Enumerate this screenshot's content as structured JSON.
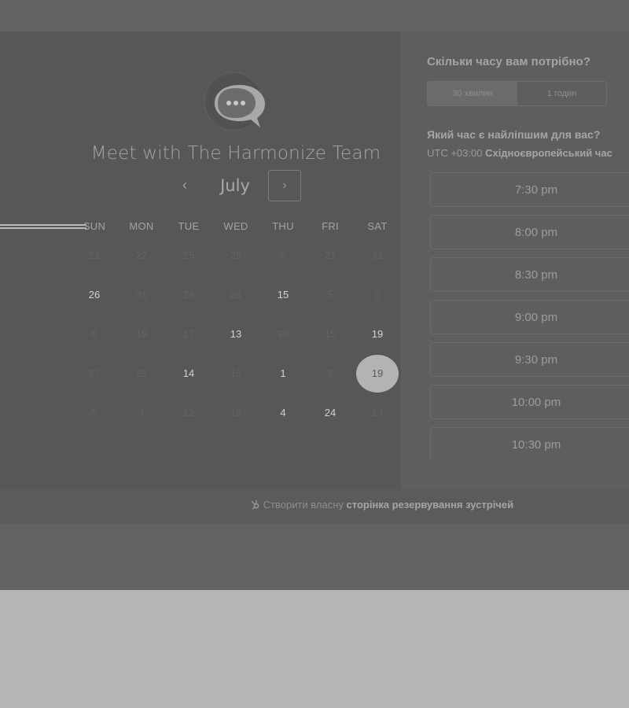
{
  "page": {
    "backdrop_color": "#b5b5b5",
    "overlay_color": "#636363"
  },
  "calendar": {
    "title": "Meet with The Harmonize Team",
    "month": "July",
    "prev_icon": "‹",
    "next_icon": "›",
    "weekdays": [
      "SUN",
      "MON",
      "TUE",
      "WED",
      "THU",
      "FRI",
      "SAT"
    ],
    "weeks": [
      [
        "21",
        "22",
        "25",
        "28",
        "6",
        "21",
        "31"
      ],
      [
        "26",
        "31",
        "29",
        "26",
        "15",
        "5",
        "8"
      ],
      [
        "6",
        "19",
        "17",
        "13",
        "30",
        "15",
        "19"
      ],
      [
        "27",
        "29",
        "14",
        "13",
        "1",
        "2",
        "19"
      ],
      [
        "5",
        "4",
        "12",
        "18",
        "4",
        "24",
        "14"
      ]
    ],
    "enabled": [
      [],
      [
        0,
        4
      ],
      [
        3,
        6
      ],
      [
        2,
        4
      ],
      [
        4,
        5
      ]
    ],
    "selected": {
      "week": 3,
      "day": 6
    }
  },
  "booking": {
    "duration_question": "Скільки часу вам потрібно?",
    "durations": [
      "30 хвилин",
      "1 годин"
    ],
    "active_duration": 0,
    "time_question": "Який час є найліпшим для вас?",
    "timezone_offset": "UTC +03:00",
    "timezone_name": "Східноєвропейський час",
    "slots": [
      "7:30 pm",
      "8:00 pm",
      "8:30 pm",
      "9:00 pm",
      "9:30 pm",
      "10:00 pm",
      "10:30 pm"
    ]
  },
  "footer": {
    "icon": "hubspot-sprocket-icon",
    "link_prefix": "Створити власну",
    "link_bold": "сторінка резервування зустрічей"
  }
}
